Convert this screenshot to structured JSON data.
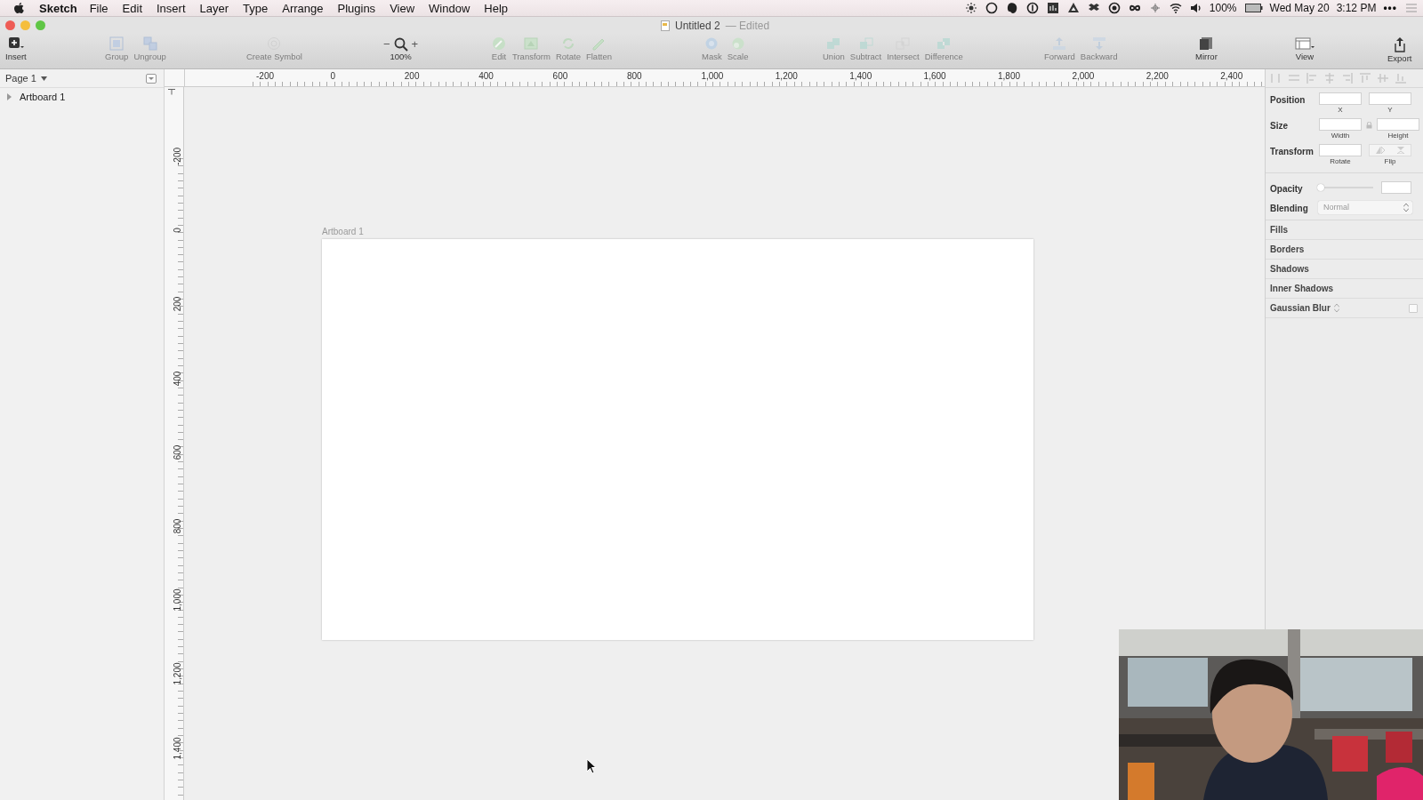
{
  "menu_bar": {
    "app": "Sketch",
    "items": [
      "File",
      "Edit",
      "Insert",
      "Layer",
      "Type",
      "Arrange",
      "Plugins",
      "View",
      "Window",
      "Help"
    ],
    "battery": "100%",
    "date": "Wed May 20",
    "time": "3:12 PM",
    "more": "•••"
  },
  "window": {
    "title": "Untitled 2",
    "status": "— Edited"
  },
  "toolbar": {
    "groups": [
      {
        "kind": "buttons",
        "items": [
          {
            "label": "Insert",
            "disabled": false
          }
        ]
      },
      {
        "kind": "buttons",
        "items": [
          {
            "label": "Group",
            "disabled": true
          },
          {
            "label": "Ungroup",
            "disabled": true
          }
        ]
      },
      {
        "kind": "buttons",
        "items": [
          {
            "label": "Create Symbol",
            "disabled": true
          }
        ]
      },
      {
        "kind": "zoom",
        "minus": "−",
        "plus": "+",
        "value": "100%"
      },
      {
        "kind": "buttons",
        "items": [
          {
            "label": "Edit",
            "disabled": true
          },
          {
            "label": "Transform",
            "disabled": true
          },
          {
            "label": "Rotate",
            "disabled": true
          },
          {
            "label": "Flatten",
            "disabled": true
          }
        ]
      },
      {
        "kind": "buttons",
        "items": [
          {
            "label": "Mask",
            "disabled": true
          },
          {
            "label": "Scale",
            "disabled": true
          }
        ]
      },
      {
        "kind": "buttons",
        "items": [
          {
            "label": "Union",
            "disabled": true
          },
          {
            "label": "Subtract",
            "disabled": true
          },
          {
            "label": "Intersect",
            "disabled": true
          },
          {
            "label": "Difference",
            "disabled": true
          }
        ]
      },
      {
        "kind": "buttons",
        "items": [
          {
            "label": "Forward",
            "disabled": true
          },
          {
            "label": "Backward",
            "disabled": true
          }
        ]
      },
      {
        "kind": "buttons",
        "items": [
          {
            "label": "Mirror",
            "disabled": false
          }
        ]
      },
      {
        "kind": "buttons",
        "items": [
          {
            "label": "View",
            "disabled": false
          }
        ]
      },
      {
        "kind": "buttons",
        "items": [
          {
            "label": "Export",
            "disabled": false
          }
        ]
      }
    ]
  },
  "layers": {
    "page": "Page 1",
    "items": [
      {
        "name": "Artboard 1",
        "expanded": false
      }
    ]
  },
  "rulers": {
    "horizontal": [
      "-200",
      "0",
      "200",
      "400",
      "600",
      "800",
      "1,000",
      "1,200",
      "1,400",
      "1,600",
      "1,800",
      "2,000",
      "2,200",
      "2,400"
    ],
    "vertical": [
      "-200",
      "0",
      "200",
      "400",
      "600",
      "800",
      "1,000",
      "1,200",
      "1,400"
    ]
  },
  "canvas": {
    "artboards": [
      {
        "name": "Artboard 1"
      }
    ]
  },
  "inspector": {
    "rows": [
      {
        "label": "Position",
        "fields": [
          {
            "kind": "input",
            "caption": "X"
          },
          {
            "kind": "input",
            "caption": "Y"
          }
        ]
      },
      {
        "label": "Size",
        "fields": [
          {
            "kind": "input",
            "caption": "Width"
          },
          {
            "kind": "input",
            "caption": "Height"
          }
        ]
      },
      {
        "label": "Transform",
        "fields": [
          {
            "kind": "input",
            "caption": "Rotate"
          },
          {
            "kind": "flip",
            "caption": "Flip"
          }
        ]
      }
    ],
    "opacity": {
      "label": "Opacity",
      "level": 0
    },
    "blending": {
      "label": "Blending",
      "value": "Normal"
    },
    "sections": [
      {
        "label": "Fills"
      },
      {
        "label": "Borders"
      },
      {
        "label": "Shadows"
      },
      {
        "label": "Inner Shadows"
      },
      {
        "label": "Gaussian Blur",
        "kind": "select",
        "checked": false
      }
    ]
  }
}
